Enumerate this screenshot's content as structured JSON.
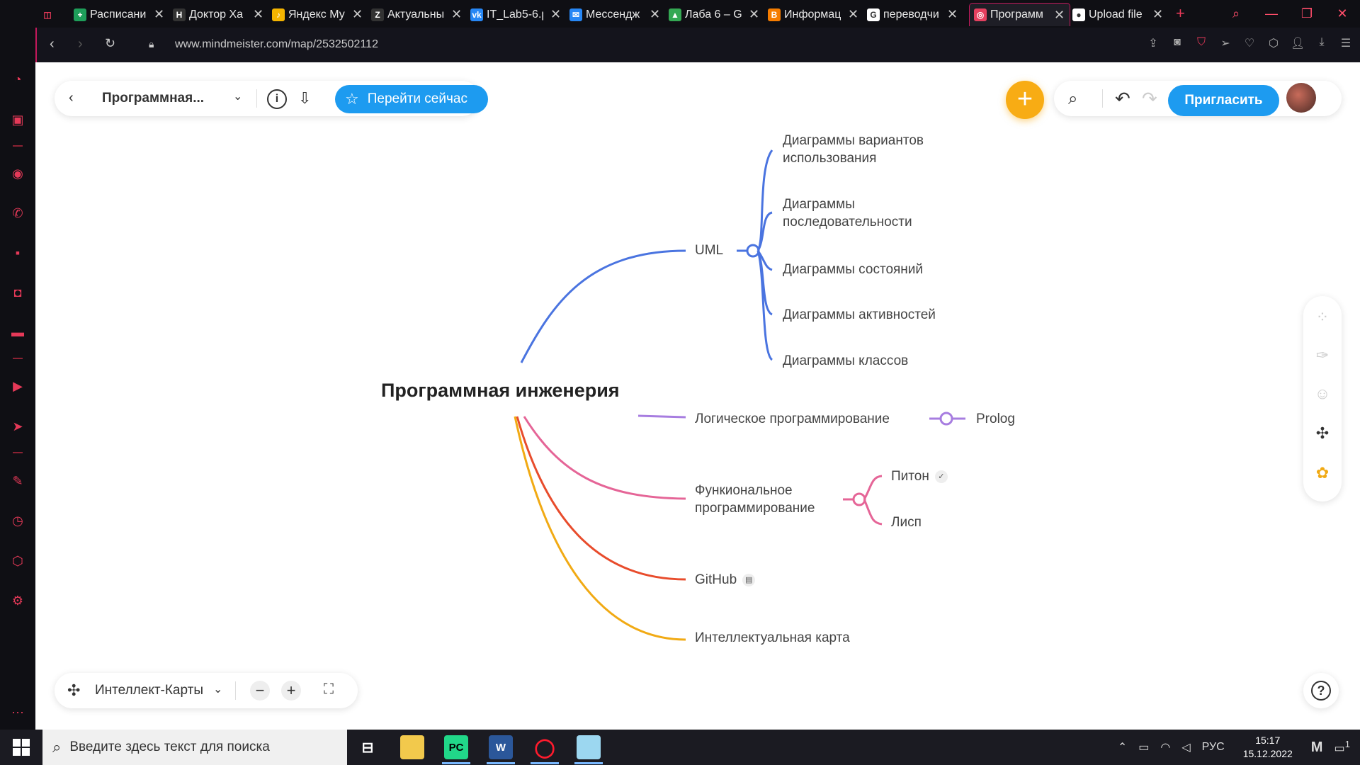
{
  "browser": {
    "tabs": [
      {
        "label": "Расписани",
        "fav_color": "#1e9e5a",
        "fav_glyph": "+"
      },
      {
        "label": "Доктор Ха",
        "fav_color": "#333",
        "fav_glyph": "H"
      },
      {
        "label": "Яндекс Му",
        "fav_color": "#f4b400",
        "fav_glyph": "♪"
      },
      {
        "label": "Актуальны",
        "fav_color": "#333",
        "fav_glyph": "Z"
      },
      {
        "label": "IT_Lab5-6.p",
        "fav_color": "#2787f5",
        "fav_glyph": "vk"
      },
      {
        "label": "Мессендж",
        "fav_color": "#2787f5",
        "fav_glyph": "✉"
      },
      {
        "label": "Лаба 6 – G",
        "fav_color": "#34a853",
        "fav_glyph": "▲"
      },
      {
        "label": "Информац",
        "fav_color": "#f57c00",
        "fav_glyph": "B"
      },
      {
        "label": "переводчи",
        "fav_color": "#ffffff",
        "fav_glyph": "G"
      },
      {
        "label": "Программ",
        "fav_color": "#e4405f",
        "fav_glyph": "◎"
      },
      {
        "label": "Upload file",
        "fav_color": "#ffffff",
        "fav_glyph": "●"
      }
    ],
    "url": "www.mindmeister.com/map/2532502112"
  },
  "toolbar": {
    "map_title": "Программная...",
    "goto_label": "Перейти сейчас",
    "invite_label": "Пригласить"
  },
  "mindmap": {
    "root": "Программная инженерия",
    "uml": {
      "label": "UML",
      "children": [
        "Диаграммы вариантов использования",
        "Диаграммы последовательности",
        "Диаграммы состояний",
        "Диаграммы активностей",
        "Диаграммы классов"
      ]
    },
    "logic": {
      "label": "Логическое программирование",
      "child": "Prolog"
    },
    "functional": {
      "label": "Функиональное программирование",
      "children": [
        "Питон",
        "Лисп"
      ]
    },
    "github": "GitHub",
    "intel": "Интеллектуальная карта",
    "colors": {
      "uml": "#4a74e0",
      "logic": "#a77de0",
      "functional": "#e56597",
      "github": "#e84c2c",
      "intel": "#f1aa14"
    }
  },
  "bottom": {
    "view_mode": "Интеллект-Карты"
  },
  "taskbar": {
    "search_placeholder": "Введите здесь текст для поиска",
    "lang": "РУС",
    "time": "15:17",
    "date": "15.12.2022",
    "notif_count": "1"
  }
}
